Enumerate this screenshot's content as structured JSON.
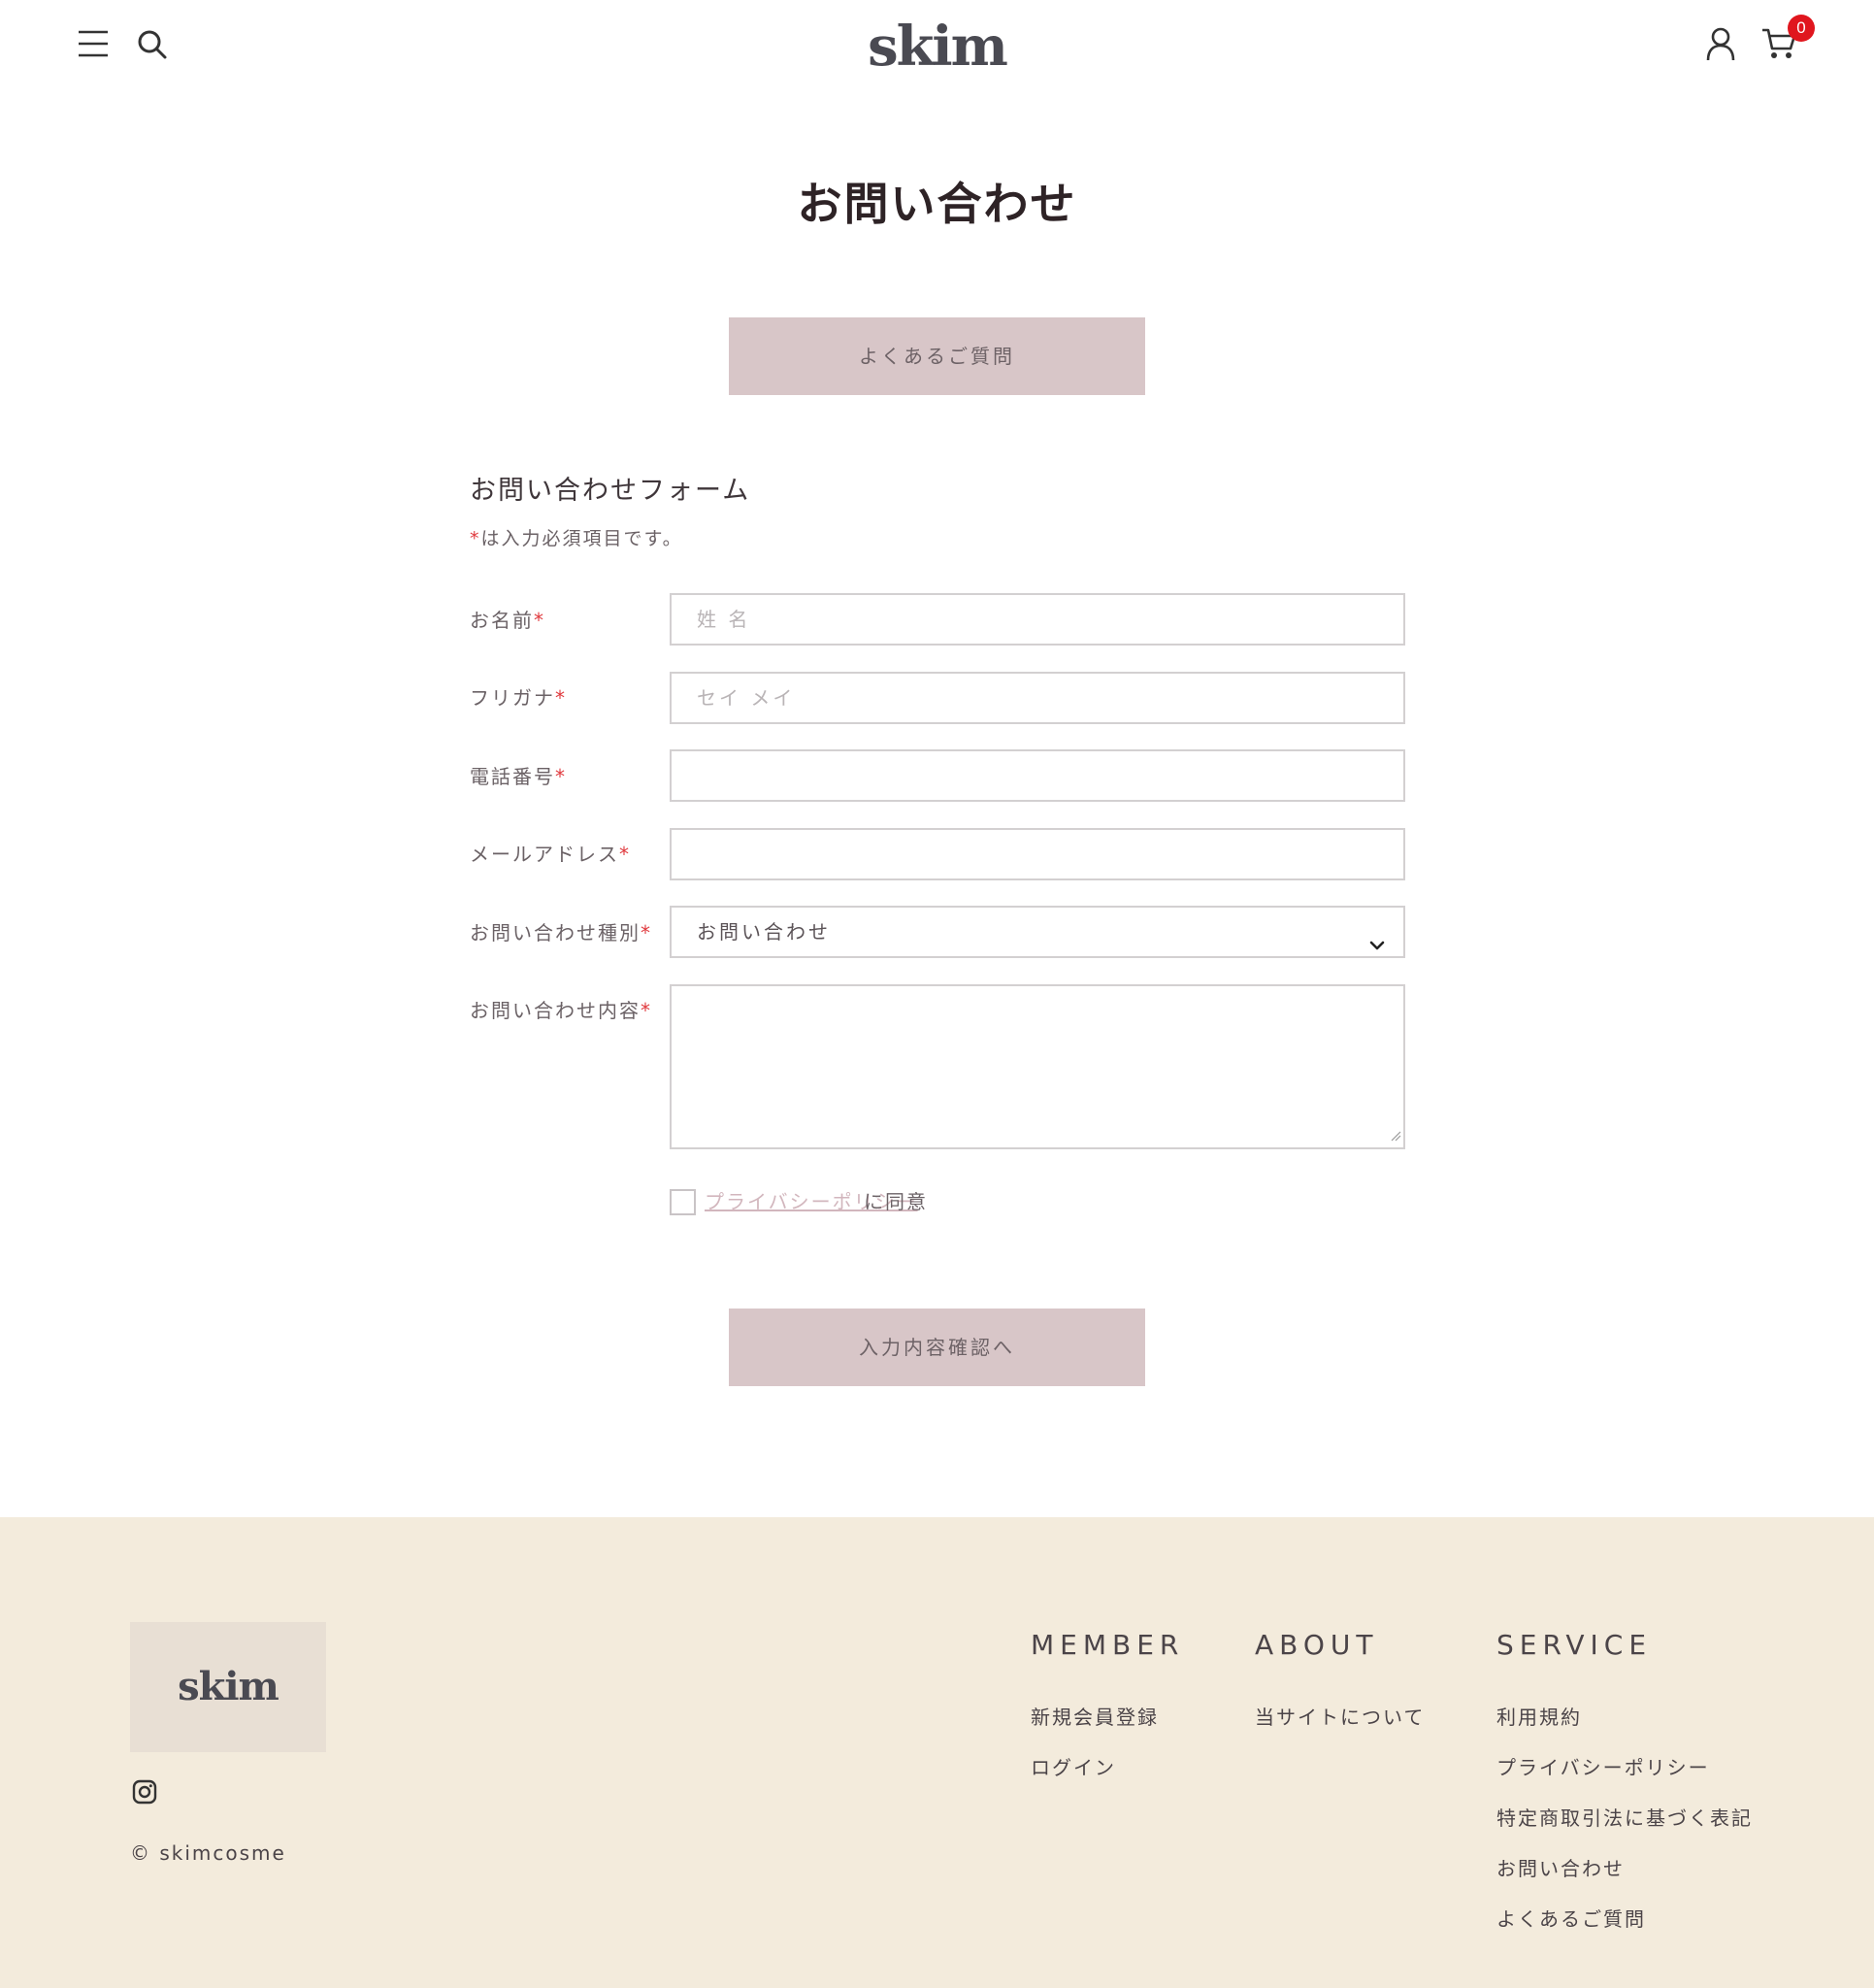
{
  "header": {
    "logo": "skim",
    "icons": [
      "menu-icon",
      "search-icon",
      "user-icon",
      "cart-icon"
    ],
    "cart_count": "0"
  },
  "main": {
    "title": "お問い合わせ",
    "faq_button": "よくあるご質問",
    "form": {
      "heading": "お問い合わせフォーム",
      "required_note": "は入力必須項目です。",
      "required_mark": "*",
      "fields": {
        "name": {
          "label": "お名前",
          "placeholder": "姓 名",
          "value": ""
        },
        "furigana": {
          "label": "フリガナ",
          "placeholder": "セイ メイ",
          "value": ""
        },
        "phone": {
          "label": "電話番号",
          "placeholder": "",
          "value": ""
        },
        "email": {
          "label": "メールアドレス",
          "placeholder": "",
          "value": ""
        },
        "inquiry_type": {
          "label": "お問い合わせ種別",
          "selected": "お問い合わせ"
        },
        "message": {
          "label": "お問い合わせ内容",
          "value": ""
        }
      },
      "privacy": {
        "link": "プライバシーポリシー",
        "suffix": "に同意",
        "checked": false
      },
      "submit": "入力内容確認へ"
    }
  },
  "footer": {
    "logo": "skim",
    "social_icon": "instagram-icon",
    "copyright": "© skimcosme",
    "columns": {
      "member": {
        "title": "MEMBER",
        "links": [
          "新規会員登録",
          "ログイン"
        ]
      },
      "about": {
        "title": "ABOUT",
        "links": [
          "当サイトについて"
        ]
      },
      "service": {
        "title": "SERVICE",
        "links": [
          "利用規約",
          "プライバシーポリシー",
          "特定商取引法に基づく表記",
          "お問い合わせ",
          "よくあるご質問"
        ]
      }
    }
  },
  "colors": {
    "button_bg": "#d8c6c8",
    "footer_bg": "#f3ebdc",
    "footer_logo_bg": "#e8dfd4",
    "required": "#e03a3e",
    "badge": "#e0161e",
    "link": "#d2b6bd"
  }
}
